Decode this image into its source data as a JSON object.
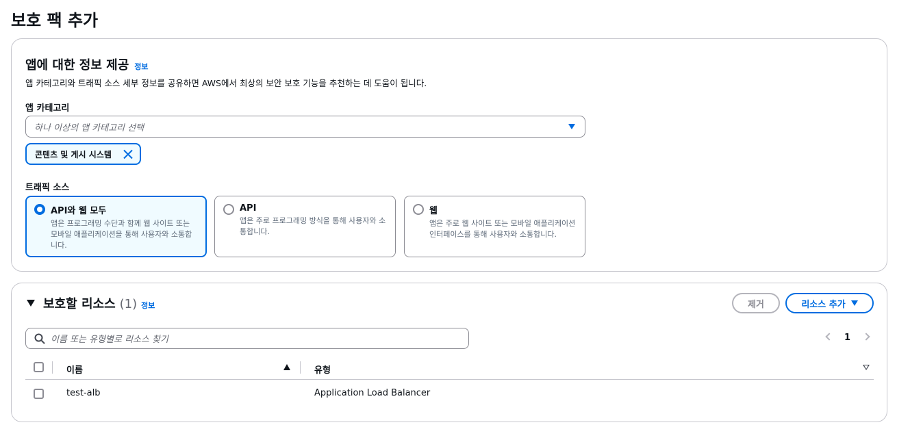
{
  "page": {
    "title": "보호 팩 추가"
  },
  "app_info": {
    "title": "앱에 대한 정보 제공",
    "info_label": "정보",
    "description": "앱 카테고리와 트래픽 소스 세부 정보를 공유하면 AWS에서 최상의 보안 보호 기능을 추천하는 데 도움이 됩니다.",
    "category_label": "앱 카테고리",
    "category_placeholder": "하나 이상의 앱 카테고리 선택",
    "selected_tokens": [
      {
        "label": "콘텐츠 및 게시 시스템"
      }
    ],
    "traffic_label": "트래픽 소스",
    "traffic_options": [
      {
        "title": "API와 웹 모두",
        "description": "앱은 프로그래밍 수단과 함께 웹 사이트 또는 모바일 애플리케이션을 통해 사용자와 소통합니다.",
        "selected": true
      },
      {
        "title": "API",
        "description": "앱은 주로 프로그래밍 방식을 통해 사용자와 소통합니다.",
        "selected": false
      },
      {
        "title": "웹",
        "description": "앱은 주로 웹 사이트 또는 모바일 애플리케이션 인터페이스를 통해 사용자와 소통합니다.",
        "selected": false
      }
    ]
  },
  "resources": {
    "title": "보호할 리소스",
    "count": "(1)",
    "info_label": "정보",
    "remove_label": "제거",
    "add_label": "리소스 추가",
    "search_placeholder": "이름 또는 유형별로 리소스 찾기",
    "current_page": "1",
    "columns": {
      "name": "이름",
      "type": "유형"
    },
    "rows": [
      {
        "name": "test-alb",
        "type": "Application Load Balancer"
      }
    ]
  },
  "colors": {
    "accent": "#006ce0",
    "border": "#c6c6cd",
    "text": "#0f141a"
  }
}
